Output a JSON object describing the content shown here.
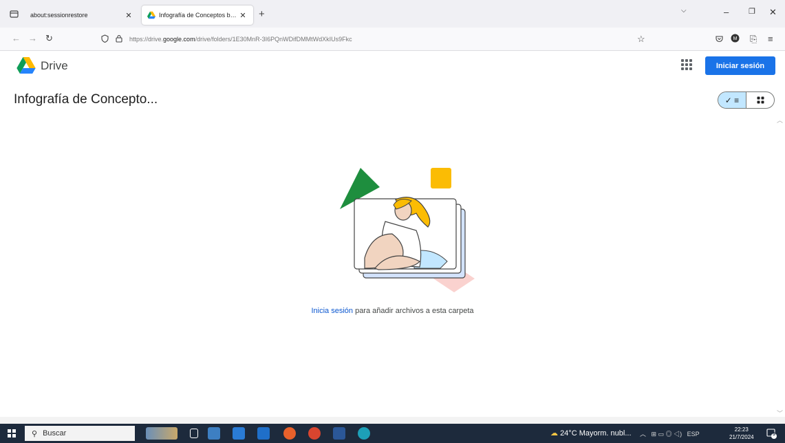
{
  "browser": {
    "tabs": [
      {
        "label": "about:sessionrestore",
        "active": false
      },
      {
        "label": "Infografía de Conceptos básicos",
        "active": true
      }
    ],
    "url_prefix": "https://drive.",
    "url_domain": "google.com",
    "url_path": "/drive/folders/1E30MnR-3I6PQnWDifDMMtWdXkIUs9Fkc"
  },
  "drive": {
    "title": "Drive",
    "signin_button": "Iniciar sesión",
    "folder_title": "Infografía de Concepto...",
    "empty_link": "Inicia sesión",
    "empty_text": " para añadir archivos a esta carpeta"
  },
  "taskbar": {
    "search_placeholder": "Buscar",
    "weather": "24°C  Mayorm. nubl...",
    "language": "ESP",
    "time": "22:23",
    "date": "21/7/2024",
    "notification_count": "5"
  },
  "colors": {
    "accent": "#1a73e8",
    "link": "#0b57d0",
    "taskbar": "#1d2a3c",
    "toggle_selected": "#c2e7ff"
  },
  "icons": [
    "tab-list-icon",
    "drive-logo-icon",
    "close-icon",
    "new-tab-icon",
    "back-icon",
    "forward-icon",
    "reload-icon",
    "shield-icon",
    "lock-icon",
    "star-icon",
    "pocket-icon",
    "account-icon",
    "extensions-icon",
    "menu-icon",
    "apps-grid-icon",
    "check-list-icon",
    "grid-view-icon",
    "windows-start-icon",
    "search-icon"
  ]
}
